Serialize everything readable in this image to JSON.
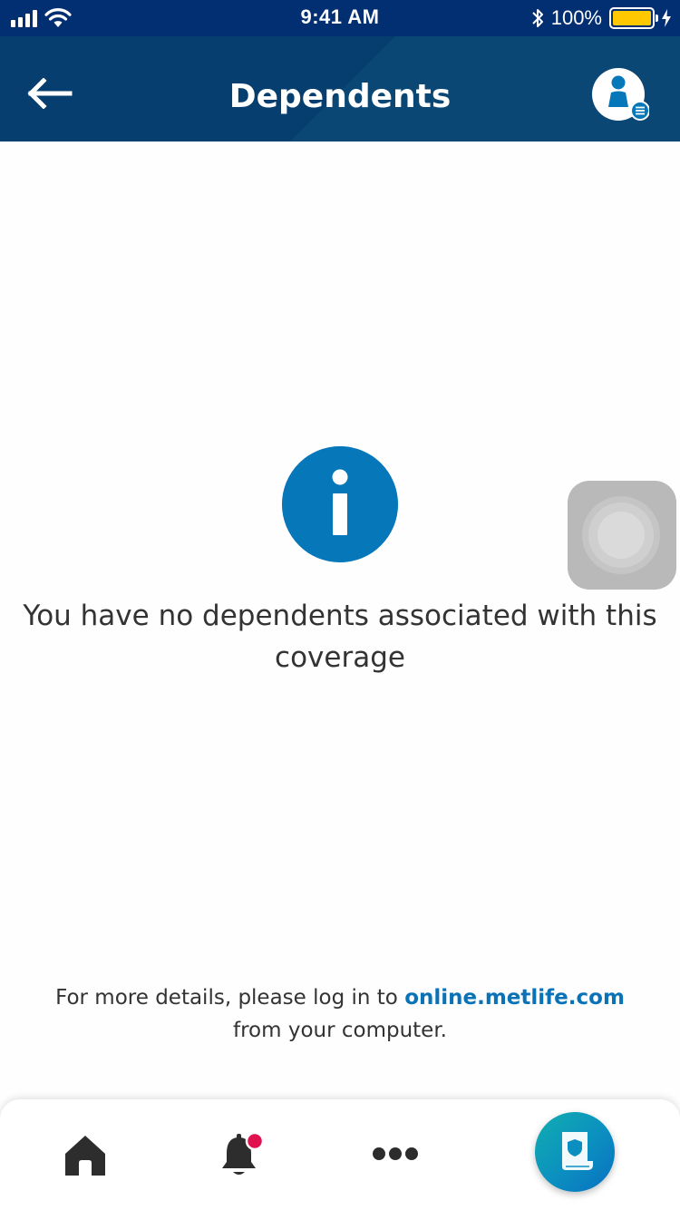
{
  "status_bar": {
    "time": "9:41 AM",
    "battery_percent": "100%",
    "icons": [
      "signal-icon",
      "wifi-icon",
      "bluetooth-icon",
      "battery-icon",
      "charging-icon"
    ],
    "battery_level": 1.0
  },
  "header": {
    "title": "Dependents",
    "back_icon": "back-arrow-icon",
    "profile_icon": "profile-menu-icon"
  },
  "content": {
    "icon": "info-icon",
    "message": "You have no dependents associated with this coverage"
  },
  "footer_note": {
    "prefix": "For more details, please log in to ",
    "link": "online.metlife.com",
    "suffix": "from your computer."
  },
  "tabbar": {
    "items": [
      {
        "icon": "home-icon"
      },
      {
        "icon": "bell-icon",
        "has_badge": true
      },
      {
        "icon": "more-icon"
      },
      {
        "icon": "policy-icon",
        "selected": true
      }
    ]
  },
  "colors": {
    "status_bar": "#022e72",
    "header": "#063f6f",
    "accent": "#0678b9",
    "link": "#0a73b8",
    "badge": "#e0114f",
    "battery": "#ffc800",
    "policy_button_start": "#11aeb0",
    "policy_button_end": "#0a6fc0"
  }
}
